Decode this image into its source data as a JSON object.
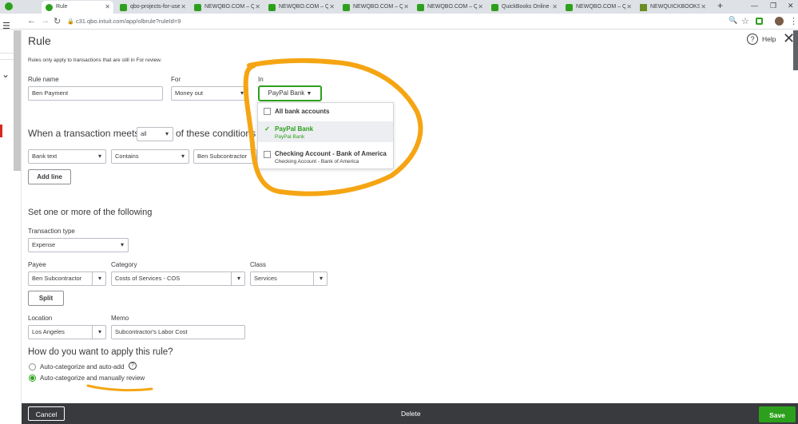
{
  "browser": {
    "tabs": [
      {
        "label": "Rule"
      },
      {
        "label": "qbo-projects-for-users"
      },
      {
        "label": "NEWQBO.COM – Quickbooks"
      },
      {
        "label": "NEWQBO.COM – Quickbooks"
      },
      {
        "label": "NEWQBO.COM – Quickbooks"
      },
      {
        "label": "NEWQBO.COM – Quickbooks"
      },
      {
        "label": "QuickBooks Online – Intuit"
      },
      {
        "label": "NEWQBO.COM – Quickbooks"
      },
      {
        "label": "NEWQUICKBOOKS.COM"
      }
    ],
    "url": "c31.qbo.intuit.com/app/olbrule?ruleId=9"
  },
  "rule": {
    "title": "Rule",
    "help_label": "Help",
    "note": "Rules only apply to transactions that are still in For review.",
    "rule_name_label": "Rule name",
    "rule_name_value": "Ben Payment",
    "for_label": "For",
    "for_value": "Money out",
    "in_label": "In",
    "in_value": "PayPal Bank"
  },
  "dropdown": {
    "items": [
      {
        "main": "All bank accounts",
        "sub": "",
        "checked": false
      },
      {
        "main": "PayPal Bank",
        "sub": "PayPal Bank",
        "checked": true
      },
      {
        "main": "Checking Account - Bank of America",
        "sub": "Checking Account - Bank of America",
        "checked": false
      }
    ]
  },
  "conditions": {
    "prefix": "When a transaction meets",
    "match_value": "all",
    "suffix": "of these conditions",
    "field_value": "Bank text",
    "operator_value": "Contains",
    "text_value": "Ben Subcontractor",
    "add_line_label": "Add line"
  },
  "set": {
    "heading": "Set one or more of the following",
    "transaction_type_label": "Transaction type",
    "transaction_type_value": "Expense",
    "payee_label": "Payee",
    "payee_value": "Ben Subcontractor",
    "category_label": "Category",
    "category_value": "Costs of Services - COS",
    "class_label": "Class",
    "class_value": "Services",
    "split_label": "Split",
    "location_label": "Location",
    "location_value": "Los Angeles",
    "memo_label": "Memo",
    "memo_value": "Subcontractor's Labor Cost"
  },
  "apply": {
    "heading": "How do you want to apply this rule?",
    "option_auto_add": "Auto-categorize and auto-add",
    "option_manual": "Auto-categorize and manually review",
    "selected": "manual"
  },
  "footer": {
    "cancel_label": "Cancel",
    "delete_label": "Delete",
    "save_label": "Save"
  },
  "colors": {
    "accent_green": "#2ca01c",
    "annotation_orange": "#f5a513",
    "footer_bg": "#393a3d"
  }
}
